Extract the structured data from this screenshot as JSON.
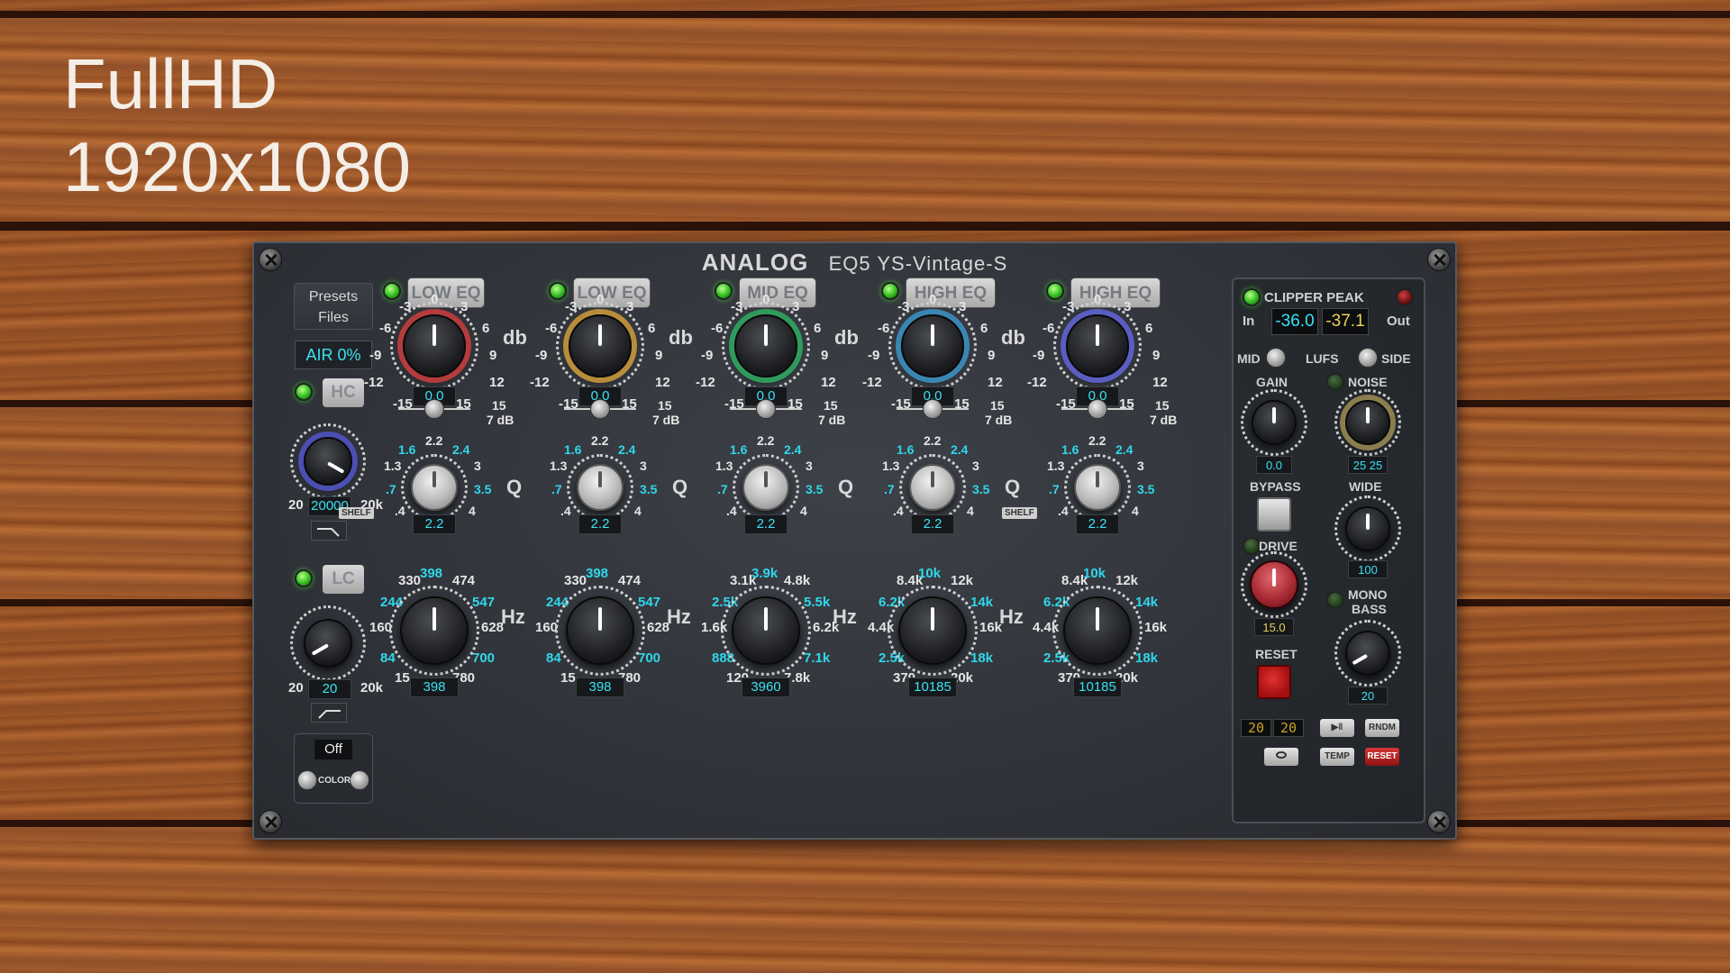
{
  "overlay": {
    "line1": "FullHD",
    "line2": "1920x1080"
  },
  "plugin": {
    "brand": "ANALOG",
    "name": "EQ5 YS-Vintage-S",
    "presets_label": "Presets",
    "files_label": "Files",
    "air": "AIR 0%",
    "hc": {
      "label": "HC",
      "min": "20",
      "max": "20k",
      "value": "20000"
    },
    "lc": {
      "label": "LC",
      "min": "20",
      "max": "20k",
      "value": "20"
    },
    "color": {
      "state": "Off",
      "label": "COLOR"
    },
    "db_label": "db",
    "q_label": "Q",
    "hz_label": "Hz",
    "shelf_label": "SHELF",
    "gain_scale": [
      "-3",
      "0",
      "3",
      "-6",
      "6",
      "-9",
      "9",
      "-12",
      "12",
      "-15",
      "15"
    ],
    "slider_right": [
      "15",
      "7 dB"
    ],
    "q_scale": [
      "2.2",
      "1.6",
      "2.4",
      "1.3",
      "3",
      ".7",
      "3.5",
      ".4",
      "4"
    ],
    "bands": [
      {
        "name": "LOW EQ",
        "gain": "0.0",
        "q": "2.2",
        "freq": "398",
        "ring": "#b43c3c",
        "hz": [
          "330",
          "398",
          "474",
          "244",
          "547",
          "160",
          "628",
          "84",
          "700",
          "15",
          "780"
        ]
      },
      {
        "name": "LOW EQ",
        "gain": "0.0",
        "q": "2.2",
        "freq": "398",
        "ring": "#b78c3b",
        "hz": [
          "330",
          "398",
          "474",
          "244",
          "547",
          "160",
          "628",
          "84",
          "700",
          "15",
          "780"
        ]
      },
      {
        "name": "MID EQ",
        "gain": "0.0",
        "q": "2.2",
        "freq": "3960",
        "ring": "#2f9a5c",
        "hz": [
          "3.1k",
          "3.9k",
          "4.8k",
          "2.5k",
          "5.5k",
          "1.6k",
          "6.2k",
          "888",
          "7.1k",
          "120",
          "7.8k"
        ]
      },
      {
        "name": "HIGH EQ",
        "gain": "0.0",
        "q": "2.2",
        "freq": "10185",
        "ring": "#3a86b3",
        "hz": [
          "8.4k",
          "10k",
          "12k",
          "6.2k",
          "14k",
          "4.4k",
          "16k",
          "2.5k",
          "18k",
          "370",
          "20k"
        ]
      },
      {
        "name": "HIGH EQ",
        "gain": "0.0",
        "q": "2.2",
        "freq": "10185",
        "ring": "#5a5ec2",
        "hz": [
          "8.4k",
          "10k",
          "12k",
          "6.2k",
          "14k",
          "4.4k",
          "16k",
          "2.5k",
          "18k",
          "370",
          "20k"
        ]
      }
    ],
    "right": {
      "clipper": "CLIPPER PEAK",
      "in_label": "In",
      "in_value": "-36.0",
      "out_label": "Out",
      "out_value": "-37.1",
      "mid": "MID",
      "lufs": "LUFS",
      "side": "SIDE",
      "gain_label": "GAIN",
      "gain_value": "0.0",
      "noise_label": "NOISE",
      "noise_value": "25 25",
      "bypass_label": "BYPASS",
      "wide_label": "WIDE",
      "wide_value": "100",
      "drive_label": "DRIVE",
      "drive_value": "15.0",
      "mono_label": "MONO",
      "bass_label": "BASS",
      "mono_value": "20",
      "reset_label": "RESET",
      "digits": [
        "20",
        "20"
      ],
      "play_label": "▶‖",
      "rndm": "RNDM",
      "temp": "TEMP",
      "reset_small": "RESET"
    }
  }
}
